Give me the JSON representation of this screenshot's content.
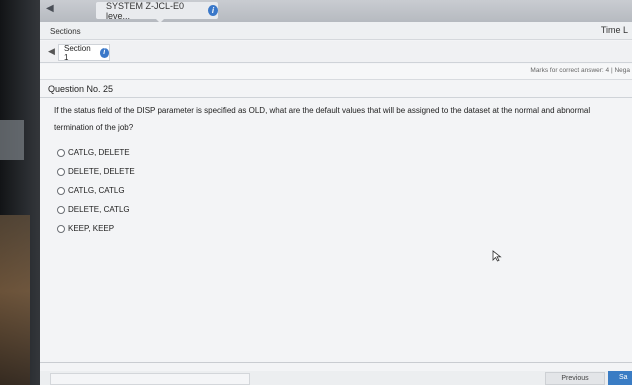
{
  "window": {
    "test_title": "SYSTEM Z-JCL-E0 leve...",
    "info_icon": "i"
  },
  "header": {
    "sections_label": "Sections",
    "time_label": "Time L"
  },
  "section_tabs": [
    {
      "label": "Section 1",
      "info_icon": "i"
    }
  ],
  "marks": {
    "text": "Marks for correct answer: 4 | Nega"
  },
  "question": {
    "number_label": "Question No. 25",
    "text": "If the status field of the DISP parameter is specified as OLD, what are the default values that will be assigned to the dataset at the normal and abnormal termination of the job?",
    "options": [
      "CATLG, DELETE",
      "DELETE, DELETE",
      "CATLG, CATLG",
      "DELETE, CATLG",
      "KEEP, KEEP"
    ]
  },
  "footer": {
    "previous_label": "Previous",
    "save_label": "Sa"
  },
  "icons": {
    "back": "chevron-left-icon",
    "cursor": "mouse-pointer-icon"
  }
}
